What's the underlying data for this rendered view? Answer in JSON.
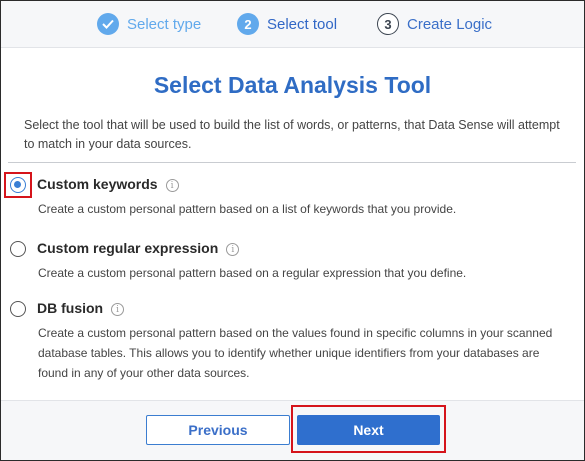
{
  "stepper": {
    "steps": [
      {
        "number": "",
        "label": "Select type",
        "state": "done"
      },
      {
        "number": "2",
        "label": "Select tool",
        "state": "active"
      },
      {
        "number": "3",
        "label": "Create Logic",
        "state": "pending"
      }
    ]
  },
  "title": "Select Data Analysis Tool",
  "description": "Select the tool that will be used to build the list of words, or patterns, that Data Sense will attempt to match in your data sources.",
  "options": [
    {
      "title": "Custom keywords",
      "selected": true,
      "description": "Create a custom personal pattern based on a list of keywords that you provide."
    },
    {
      "title": "Custom regular expression",
      "selected": false,
      "description": "Create a custom personal pattern based on a regular expression that you define."
    },
    {
      "title": "DB fusion",
      "selected": false,
      "description": "Create a custom personal pattern based on the values found in specific columns in your scanned database tables. This allows you to identify whether unique identifiers from your databases are found in any of your other data sources."
    }
  ],
  "info_glyph": "i",
  "buttons": {
    "previous": "Previous",
    "next": "Next"
  },
  "colors": {
    "accent": "#2f6fce",
    "highlight": "#d5141b"
  }
}
